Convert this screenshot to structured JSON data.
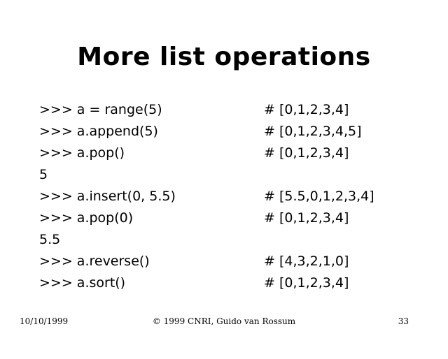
{
  "title": "More list operations",
  "lines": [
    {
      "code": ">>> a = range(5)",
      "comment": "# [0,1,2,3,4]"
    },
    {
      "code": ">>> a.append(5)",
      "comment": "# [0,1,2,3,4,5]"
    },
    {
      "code": ">>> a.pop()",
      "comment": "# [0,1,2,3,4]"
    },
    {
      "code": "5",
      "comment": ""
    },
    {
      "code": ">>> a.insert(0, 5.5)",
      "comment": "# [5.5,0,1,2,3,4]"
    },
    {
      "code": ">>> a.pop(0)",
      "comment": "# [0,1,2,3,4]"
    },
    {
      "code": "5.5",
      "comment": ""
    },
    {
      "code": ">>> a.reverse()",
      "comment": "# [4,3,2,1,0]"
    },
    {
      "code": ">>> a.sort()",
      "comment": "# [0,1,2,3,4]"
    }
  ],
  "footer": {
    "date": "10/10/1999",
    "copyright": "© 1999 CNRI, Guido van Rossum",
    "page_number": "33"
  }
}
